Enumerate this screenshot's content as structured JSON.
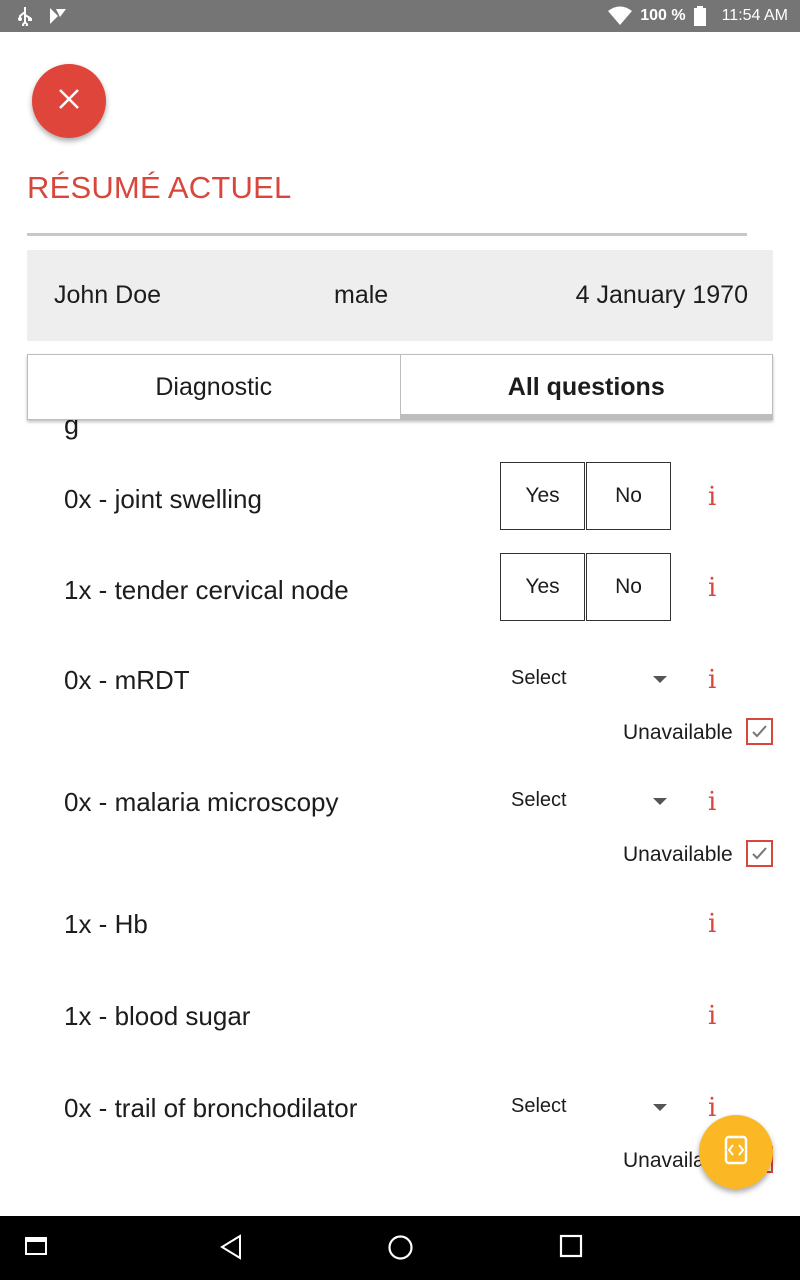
{
  "status_bar": {
    "battery": "100 %",
    "time": "11:54 AM",
    "icons": [
      "usb-icon",
      "notification-icon",
      "wifi-icon",
      "battery-icon"
    ]
  },
  "header": {
    "close_icon": "close-icon",
    "title": "RÉSUMÉ ACTUEL",
    "accent_color": "#d9463c"
  },
  "patient": {
    "name": "John Doe",
    "gender": "male",
    "birth_date": "4 January 1970"
  },
  "tabs": [
    {
      "label": "Diagnostic",
      "active": false
    },
    {
      "label": "All questions",
      "active": true
    }
  ],
  "partial_text": "g",
  "questions": [
    {
      "label": "0x - joint swelling",
      "type": "yes_no",
      "yes": "Yes",
      "no": "No",
      "info": "i"
    },
    {
      "label": "1x - tender cervical node",
      "type": "yes_no",
      "yes": "Yes",
      "no": "No",
      "info": "i"
    },
    {
      "label": "0x - mRDT",
      "type": "select",
      "select_value": "Select",
      "unavailable_label": "Unavailable",
      "unavailable_checked": true,
      "info": "i"
    },
    {
      "label": "0x - malaria microscopy",
      "type": "select",
      "select_value": "Select",
      "unavailable_label": "Unavailable",
      "unavailable_checked": true,
      "info": "i"
    },
    {
      "label": "1x - Hb",
      "type": "none",
      "info": "i"
    },
    {
      "label": "1x - blood sugar",
      "type": "none",
      "info": "i"
    },
    {
      "label": "0x - trail of bronchodilator",
      "type": "select",
      "select_value": "Select",
      "unavailable_label": "Unavailable",
      "unavailable_checked": true,
      "info": "i"
    }
  ],
  "fab_icon": "code-brackets-icon",
  "fab_color": "#fbb824",
  "nav_bar": [
    "recent-apps-icon",
    "back-icon",
    "home-icon",
    "overview-icon"
  ]
}
